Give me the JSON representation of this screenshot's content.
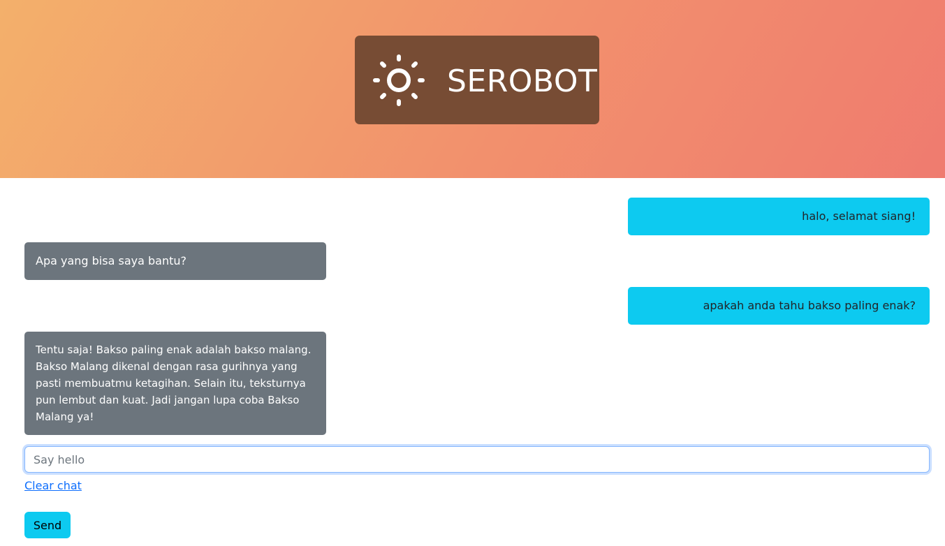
{
  "header": {
    "logo_icon": "sun-icon",
    "title": "SEROBOT",
    "brand_bg": "#774c34",
    "gradient": [
      "#f3b06b",
      "#ef7b6f"
    ]
  },
  "chat": {
    "messages": [
      {
        "from": "user",
        "text": "halo, selamat siang!"
      },
      {
        "from": "bot",
        "text": "Apa yang bisa saya bantu?"
      },
      {
        "from": "user",
        "text": "apakah anda tahu bakso paling enak?"
      },
      {
        "from": "bot",
        "text": "Tentu saja! Bakso paling enak adalah bakso malang. Bakso Malang dikenal dengan rasa gurihnya yang pasti membuatmu ketagihan. Selain itu, teksturnya pun lembut dan kuat. Jadi jangan lupa coba Bakso Malang ya!"
      }
    ],
    "user_color": "#0dcaf0",
    "bot_color": "#6c757d"
  },
  "composer": {
    "placeholder": "Say hello",
    "value": "",
    "clear_label": "Clear chat",
    "send_label": "Send"
  }
}
